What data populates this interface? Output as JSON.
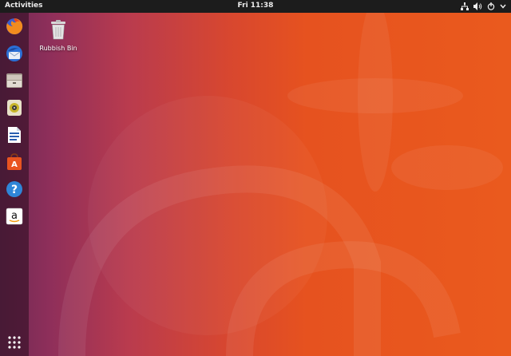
{
  "topbar": {
    "activities_label": "Activities",
    "clock": "Fri 11:38",
    "tray_icons": [
      "network-icon",
      "volume-icon",
      "power-icon",
      "chevron-down-icon"
    ]
  },
  "dock": {
    "items": [
      {
        "app": "Firefox",
        "icon": "firefox-icon"
      },
      {
        "app": "Thunderbird",
        "icon": "thunderbird-icon"
      },
      {
        "app": "Files",
        "icon": "files-icon"
      },
      {
        "app": "Rhythmbox",
        "icon": "rhythmbox-icon"
      },
      {
        "app": "LibreOffice Writer",
        "icon": "writer-icon"
      },
      {
        "app": "Ubuntu Software",
        "icon": "software-icon"
      },
      {
        "app": "Help",
        "icon": "help-icon"
      },
      {
        "app": "Amazon",
        "icon": "amazon-icon"
      }
    ],
    "show_apps_icon": "app-grid-icon"
  },
  "desktop": {
    "trash_label": "Rubbish Bin"
  },
  "colors": {
    "topbar": "#1c1c1c",
    "wallpaper_left": "#6f2a55",
    "wallpaper_right": "#ea5a1e"
  }
}
